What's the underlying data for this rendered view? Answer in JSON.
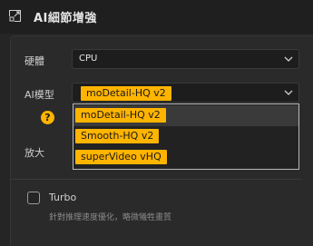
{
  "header": {
    "title": "AI細節增強",
    "icon": "expand-arrows-icon"
  },
  "hardware": {
    "label": "硬體",
    "value": "CPU"
  },
  "ai_model": {
    "label": "AI模型",
    "selected": "moDetail-HQ  v2",
    "options": [
      "moDetail-HQ  v2",
      "Smooth-HQ  v2",
      "superVideo vHQ"
    ]
  },
  "help": {
    "symbol": "?"
  },
  "scale": {
    "label": "放大"
  },
  "turbo": {
    "label": "Turbo",
    "checked": false,
    "description": "針對推理速度優化，略微犧牲畫質"
  },
  "colors": {
    "accent": "#ffb400",
    "background": "#252525",
    "panel": "#2a2a2a"
  }
}
